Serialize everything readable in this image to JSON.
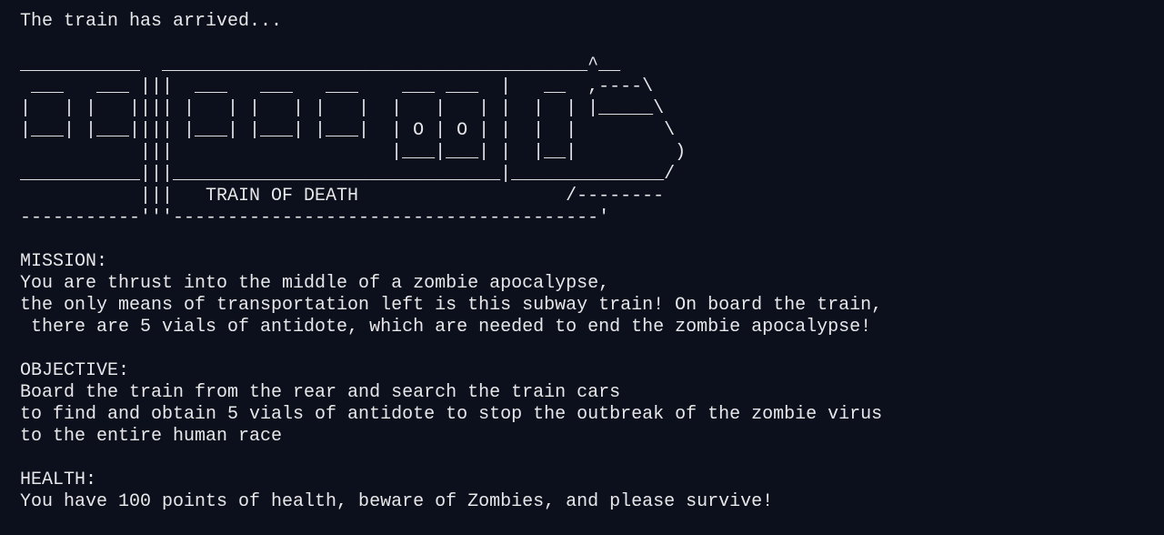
{
  "terminal": {
    "intro": "The train has arrived...",
    "ascii_art": [
      "___________  _______________________________________^__",
      " ___   ___ |||  ___   ___   ___    ___ ___  |   __  ,----\\",
      "|   | |   |||| |   | |   | |   |  |   |   | |  |  | |_____\\",
      "|___| |___|||| |___| |___| |___|  | O | O | |  |  |        \\",
      "           |||                    |___|___| |  |__|         )",
      "___________|||______________________________|______________/",
      "           |||   TRAIN OF DEATH                   /--------",
      "-----------'''---------------------------------------'"
    ],
    "mission": {
      "heading": "MISSION:",
      "lines": [
        "You are thrust into the middle of a zombie apocalypse,",
        "the only means of transportation left is this subway train! On board the train,",
        " there are 5 vials of antidote, which are needed to end the zombie apocalypse!"
      ]
    },
    "objective": {
      "heading": "OBJECTIVE:",
      "lines": [
        "Board the train from the rear and search the train cars",
        "to find and obtain 5 vials of antidote to stop the outbreak of the zombie virus",
        "to the entire human race"
      ]
    },
    "health": {
      "heading": "HEALTH:",
      "lines": [
        "You have 100 points of health, beware of Zombies, and please survive!"
      ]
    }
  },
  "colors": {
    "background": "#0c0f1c",
    "text": "#e8e8ea"
  }
}
